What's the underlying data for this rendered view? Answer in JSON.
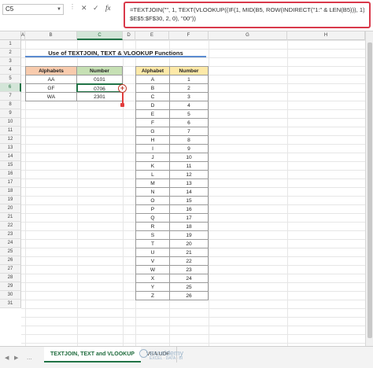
{
  "formula_bar": {
    "name_box": "C5",
    "dots": "⋮",
    "cancel": "✕",
    "enter": "✓",
    "fx": "fx",
    "formula_line1": "=TEXTJOIN(\"\", 1, TEXT(VLOOKUP((IF(1, MID(B5, ROW(INDIRECT(\"1:\" & LEN(B5))), 1))),",
    "formula_line2": "$E$5:$F$30, 2, 0), \"00\"))"
  },
  "columns": [
    "A",
    "B",
    "C",
    "D",
    "E",
    "F",
    "G",
    "H"
  ],
  "rows": [
    "1",
    "2",
    "3",
    "4",
    "5",
    "6",
    "7",
    "8",
    "9",
    "10",
    "11",
    "12",
    "13",
    "14",
    "15",
    "16",
    "17",
    "18",
    "19",
    "20",
    "21",
    "22",
    "23",
    "24",
    "25",
    "26",
    "27",
    "28",
    "29",
    "30",
    "31"
  ],
  "title": "Use of TEXTJOIN, TEXT & VLOOKUP Functions",
  "left_table": {
    "headers": [
      "Alphabets",
      "Number"
    ],
    "rows": [
      [
        "AA",
        "0101"
      ],
      [
        "GF",
        "0706"
      ],
      [
        "WA",
        "2301"
      ]
    ]
  },
  "right_table": {
    "headers": [
      "Alphabet",
      "Number"
    ],
    "rows": [
      [
        "A",
        "1"
      ],
      [
        "B",
        "2"
      ],
      [
        "C",
        "3"
      ],
      [
        "D",
        "4"
      ],
      [
        "E",
        "5"
      ],
      [
        "F",
        "6"
      ],
      [
        "G",
        "7"
      ],
      [
        "H",
        "8"
      ],
      [
        "I",
        "9"
      ],
      [
        "J",
        "10"
      ],
      [
        "K",
        "11"
      ],
      [
        "L",
        "12"
      ],
      [
        "M",
        "13"
      ],
      [
        "N",
        "14"
      ],
      [
        "O",
        "15"
      ],
      [
        "P",
        "16"
      ],
      [
        "Q",
        "17"
      ],
      [
        "R",
        "18"
      ],
      [
        "S",
        "19"
      ],
      [
        "T",
        "20"
      ],
      [
        "U",
        "21"
      ],
      [
        "V",
        "22"
      ],
      [
        "W",
        "23"
      ],
      [
        "X",
        "24"
      ],
      [
        "Y",
        "25"
      ],
      [
        "Z",
        "26"
      ]
    ]
  },
  "sheet_tabs": {
    "prev": "◀",
    "next": "▶",
    "ellipsis": "...",
    "tabs": [
      "TEXTJOIN, TEXT and VLOOKUP",
      "VBA UDF"
    ]
  },
  "watermark": {
    "name": "exceldemy",
    "tagline": "EXCEL · DATA · BI"
  },
  "colors": {
    "accent_green": "#217346",
    "formula_highlight": "#d9394a",
    "header_orange": "#f8cbad",
    "header_green": "#c6e0b4",
    "header_yellow": "#fde9a8"
  }
}
